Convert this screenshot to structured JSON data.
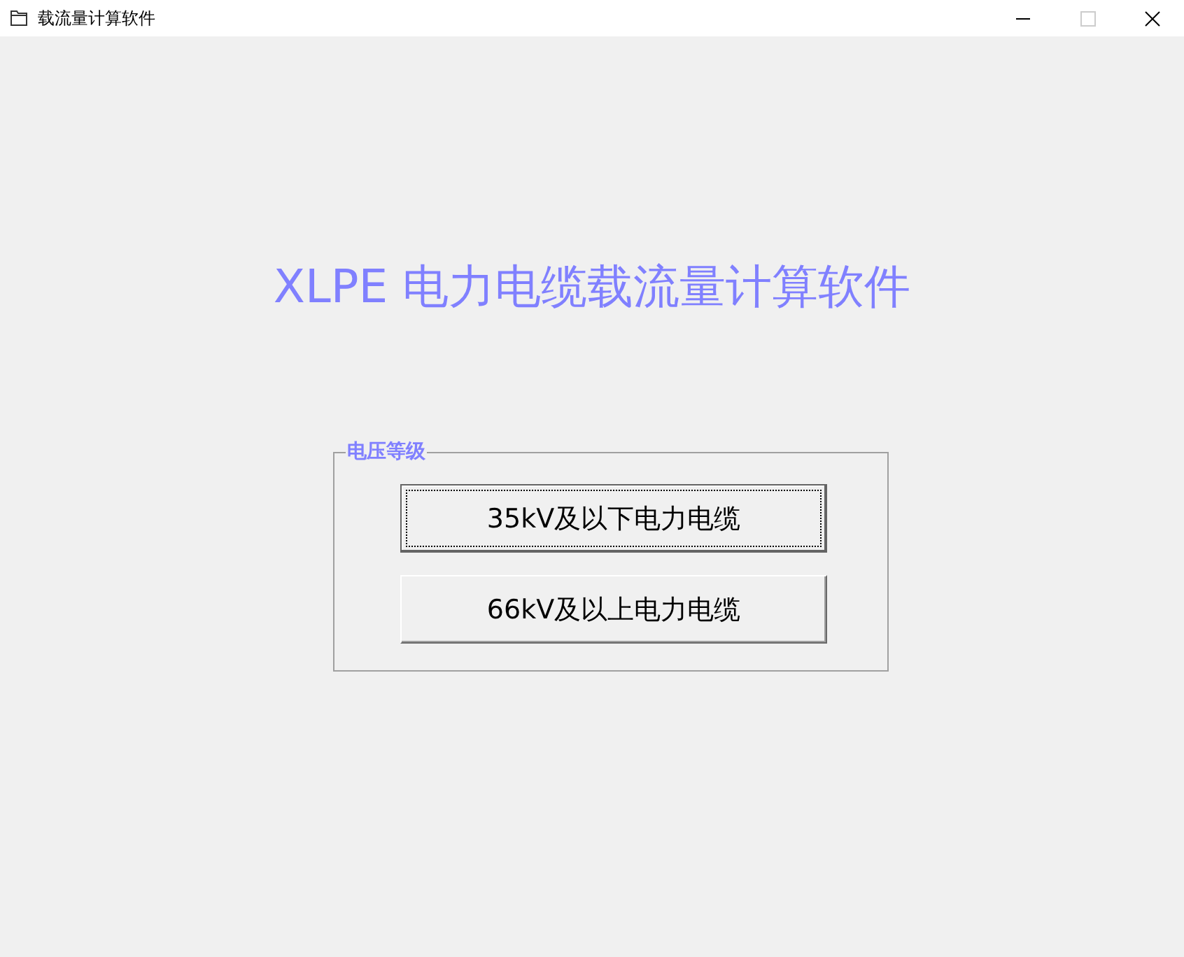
{
  "window": {
    "title": "载流量计算软件"
  },
  "heading": "XLPE 电力电缆载流量计算软件",
  "group": {
    "label": "电压等级",
    "buttons": [
      {
        "label": "35kV及以下电力电缆",
        "focused": true
      },
      {
        "label": "66kV及以上电力电缆",
        "focused": false
      }
    ]
  }
}
